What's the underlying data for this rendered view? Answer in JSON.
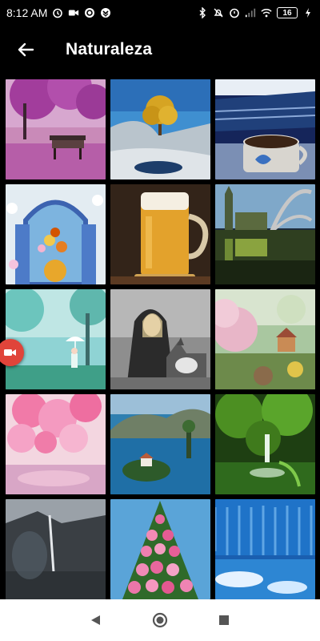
{
  "status_bar": {
    "time": "8:12 AM",
    "battery": "16"
  },
  "app_bar": {
    "title": "Naturaleza",
    "back_icon": "arrow-left-icon"
  },
  "gallery": {
    "items": [
      "pink-tree-bench",
      "golden-tree-rocks",
      "coffee-cup-lake",
      "flower-window",
      "beer-mug",
      "london-reflection",
      "girl-umbrella",
      "woman-wolf",
      "pink-blossom-house",
      "cherry-blossom",
      "lake-island",
      "green-waterfall",
      "mountain-waterfall",
      "rose-tree",
      "blue-waterfall"
    ]
  },
  "colors": {
    "background": "#000000",
    "nav_bar": "#ffffff",
    "record_bubble": "#e0443a"
  }
}
